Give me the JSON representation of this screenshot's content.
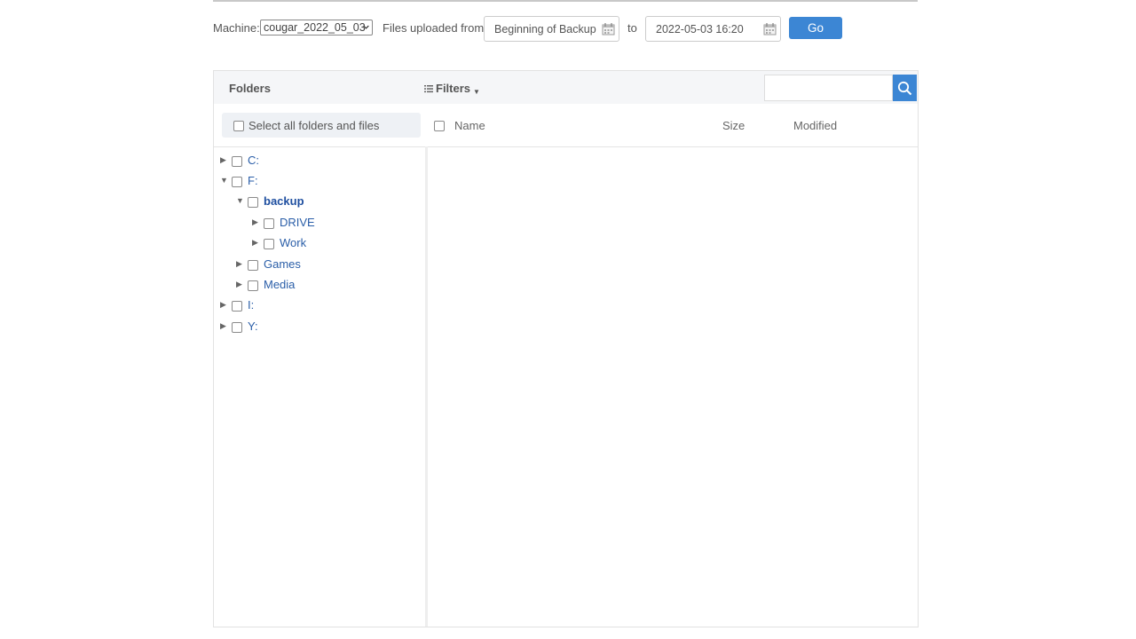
{
  "toolbar": {
    "machine_label": "Machine:",
    "machine_value": "cougar_2022_05_03",
    "uploaded_label": "Files uploaded from:",
    "from_value": "Beginning of Backup",
    "to_label": "to",
    "to_value": "2022-05-03 16:20",
    "go_label": "Go"
  },
  "panel": {
    "folders_title": "Folders",
    "filters_label": "Filters",
    "search_placeholder": "",
    "select_all_label": "Select all folders and files",
    "columns": {
      "name": "Name",
      "size": "Size",
      "modified": "Modified"
    }
  },
  "tree": [
    {
      "label": "C:",
      "expanded": false
    },
    {
      "label": "F:",
      "expanded": true
    },
    {
      "label": "backup",
      "expanded": true,
      "selected": true
    },
    {
      "label": "DRIVE",
      "expanded": false
    },
    {
      "label": "Work",
      "expanded": false
    },
    {
      "label": "Games",
      "expanded": false
    },
    {
      "label": "Media",
      "expanded": false
    },
    {
      "label": "I:",
      "expanded": false
    },
    {
      "label": "Y:",
      "expanded": false
    }
  ],
  "colors": {
    "accent": "#3c86d4",
    "link": "#2a5ea8",
    "header_bg": "#f5f6f8"
  }
}
